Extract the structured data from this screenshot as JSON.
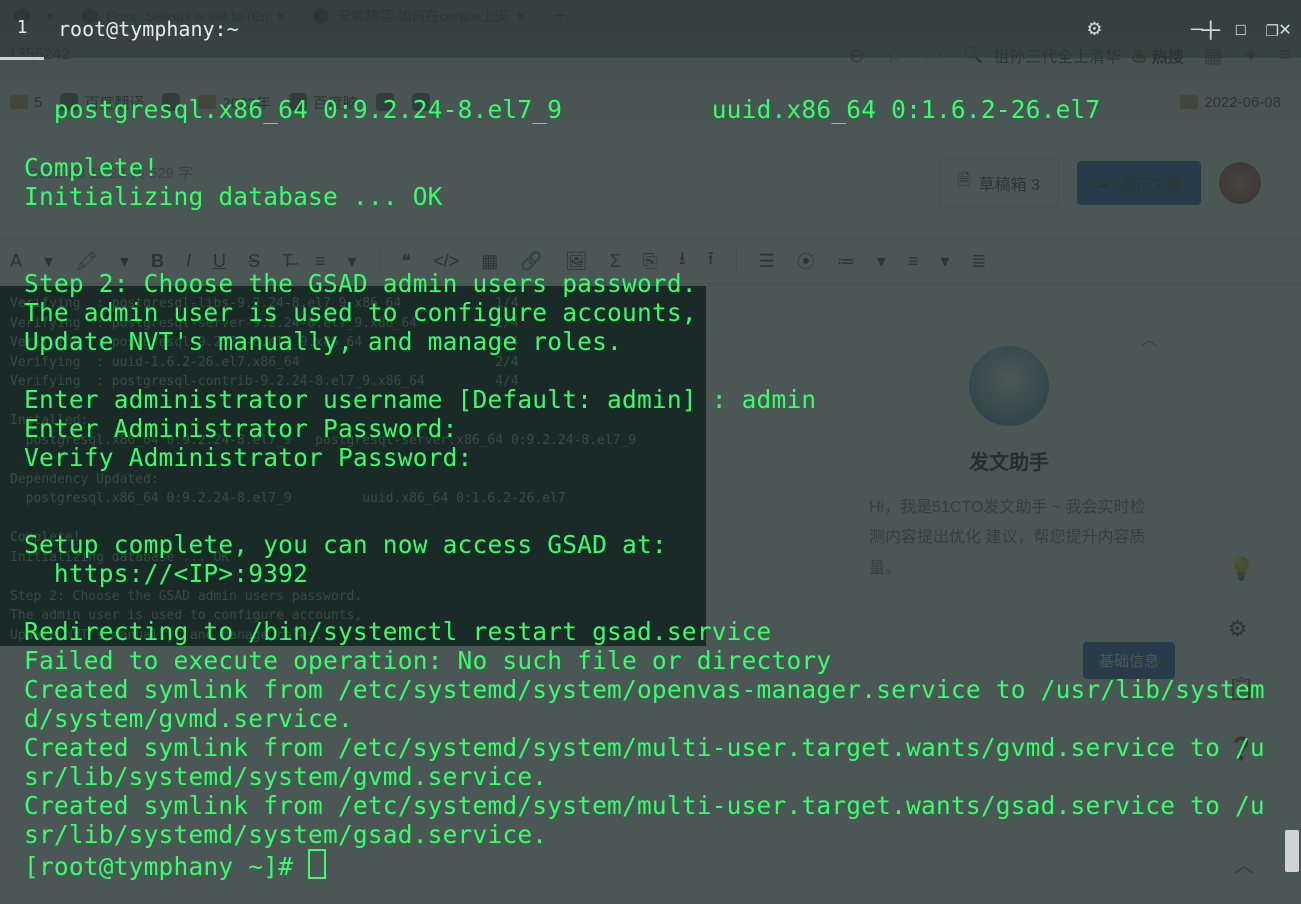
{
  "browser": {
    "tabs": [
      {
        "title": "",
        "close": "×"
      },
      {
        "title": "Error: Selinux is set to (En",
        "close": "×"
      },
      {
        "title": "安装随笔-如何在centos上安",
        "close": "×"
      }
    ],
    "address_id": "1355242",
    "toolbar_icons": [
      "zoom-out",
      "star",
      "more"
    ],
    "search_placeholder": "祖孙三代全上清华",
    "hot_label": "热搜",
    "right_icons": [
      "apps",
      "extensions",
      "menu"
    ],
    "bookmarks": [
      {
        "kind": "folder",
        "label": "5"
      },
      {
        "kind": "site",
        "label": "百度翻译"
      },
      {
        "kind": "site",
        "label": ""
      },
      {
        "kind": "folder",
        "label": "2022年"
      },
      {
        "kind": "site",
        "label": "百度脑"
      },
      {
        "kind": "site",
        "label": ""
      },
      {
        "kind": "site",
        "label": ""
      },
      {
        "kind": "folder",
        "label": "2022-06-08"
      }
    ]
  },
  "editor": {
    "meta": "2022-08   11:23   共 529 字",
    "draft_btn": "草稿箱 3",
    "publish_btn": "发布文章",
    "toolbar": [
      "A",
      "▾",
      "🖍",
      "▾",
      "B",
      "I",
      "U",
      "S",
      "T̶",
      "≡",
      "▾",
      "|",
      "❝",
      "</>",
      "▦",
      "🔗",
      "🖼",
      "Σ",
      "⎘",
      "⭳",
      "⭱",
      "|",
      "☰",
      "⦿",
      "≔",
      "▾",
      "≡",
      "▾",
      "≣"
    ],
    "assistant": {
      "title": "发文助手",
      "desc": "Hi，我是51CTO发文助手 ~\n我会实时检测内容提出优化\n建议，帮您提升内容质量。",
      "collapse": "︿"
    },
    "chip": "基础信息",
    "rail_icons": [
      "bulb",
      "gear",
      "clipboard",
      "help"
    ],
    "mini_terminal": "Verifying  : postgresql-libs-9.2.24-8.el7_9.x86_64            1/4\nVerifying  : postgresql-server-9.2.24-8.el7_9.x86_64          2/4\nVerifying  : postgresql-9.2.24-8.el7_9.x86_64                 3/4\nVerifying  : uuid-1.6.2-26.el7.x86_64                         2/4\nVerifying  : postgresql-contrib-9.2.24-8.el7_9.x86_64         4/4\n\nInstalled:\n  postgresql.x86_64 0:9.2.24-8.el7_9   postgresql-server.x86_64 0:9.2.24-8.el7_9\n\nDependency Updated:\n  postgresql.x86_64 0:9.2.24-8.el7_9         uuid.x86_64 0:1.6.2-26.el7\n\nComplete!\nInitializing database ... OK\n\nStep 2: Choose the GSAD admin users password.\nThe admin user is used to configure accounts,\nUpdate NVT's manually, and manage roles.\n\nEnter administrator username [Default: admin] : admin\nEnter Administrator Password:\nVerify Administrator Password:"
  },
  "terminal": {
    "tab_index": "1",
    "title": "root@tymphany:~",
    "lines": [
      "",
      "  postgresql.x86_64 0:9.2.24-8.el7_9          uuid.x86_64 0:1.6.2-26.el7",
      "",
      "Complete!",
      "Initializing database ... OK",
      "",
      "",
      "Step 2: Choose the GSAD admin users password.",
      "The admin user is used to configure accounts,",
      "Update NVT's manually, and manage roles.",
      "",
      "Enter administrator username [Default: admin] : admin",
      "Enter Administrator Password:",
      "Verify Administrator Password:",
      "",
      "",
      "Setup complete, you can now access GSAD at:",
      "  https://<IP>:9392",
      "",
      "Redirecting to /bin/systemctl restart gsad.service",
      "Failed to execute operation: No such file or directory",
      "Created symlink from /etc/systemd/system/openvas-manager.service to /usr/lib/systemd/system/gvmd.service.",
      "Created symlink from /etc/systemd/system/multi-user.target.wants/gvmd.service to /usr/lib/systemd/system/gvmd.service.",
      "Created symlink from /etc/systemd/system/multi-user.target.wants/gsad.service to /usr/lib/systemd/system/gsad.service."
    ],
    "prompt": "[root@tymphany ~]# "
  }
}
